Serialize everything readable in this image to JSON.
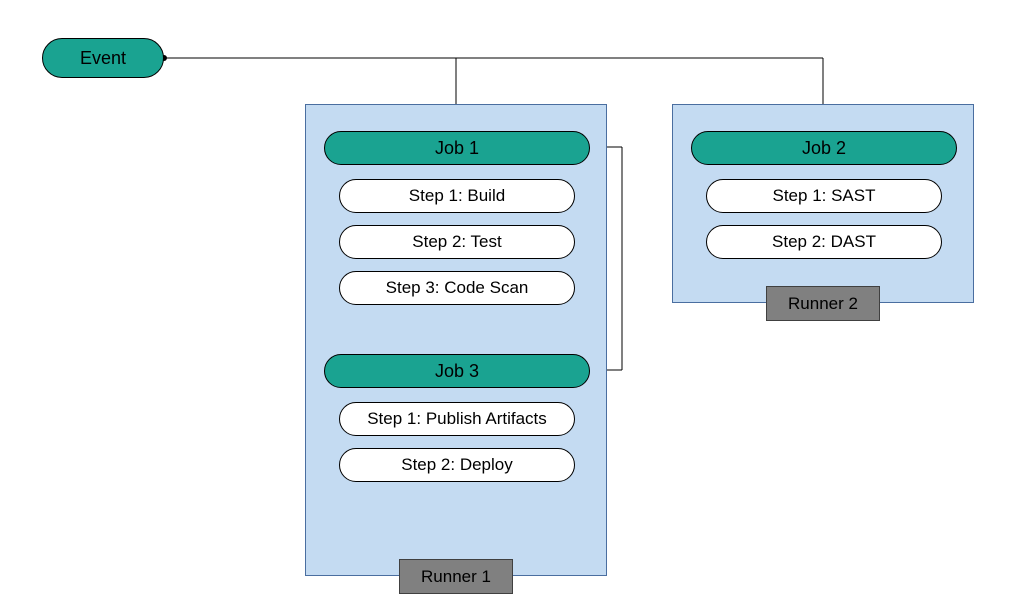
{
  "event": {
    "label": "Event"
  },
  "runner1": {
    "label": "Runner 1",
    "job1": {
      "label": "Job 1",
      "steps": [
        "Step 1: Build",
        "Step 2: Test",
        "Step 3: Code Scan"
      ]
    },
    "job3": {
      "label": "Job 3",
      "steps": [
        "Step 1: Publish Artifacts",
        "Step 2: Deploy"
      ]
    }
  },
  "runner2": {
    "label": "Runner 2",
    "job2": {
      "label": "Job 2",
      "steps": [
        "Step 1: SAST",
        "Step 2: DAST"
      ]
    }
  },
  "colors": {
    "accent": "#1aa391",
    "panel": "#c4dbf2",
    "runnerLabel": "#808080"
  }
}
